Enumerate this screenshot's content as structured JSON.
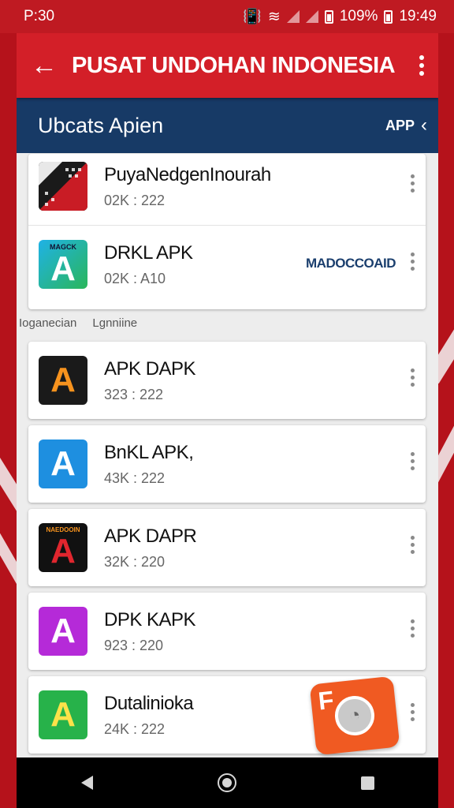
{
  "status_bar": {
    "time_left": "P:30",
    "battery_text": "109%",
    "time_right": "19:49"
  },
  "toolbar": {
    "title": "PUSAT UNDOHAN INDONESIA"
  },
  "section": {
    "title": "Ubcats Apien",
    "link": "APP",
    "link_icon": "chevron-left-icon"
  },
  "top_apps": [
    {
      "name": "PuyaNedgenInourah",
      "meta": "02K : 222",
      "icon": "flag-pattern-icon"
    },
    {
      "name": "DRKL APK",
      "meta": "02K : A10",
      "icon": "ap-logo-icon",
      "icon_text": "MAGCK",
      "tag": "MADOCCOAID"
    }
  ],
  "labels": [
    "Ioganecian",
    "Lgnniine"
  ],
  "apps": [
    {
      "name": "APK DAPK",
      "meta": "323 : 222",
      "icon": "a-logo-dark-icon"
    },
    {
      "name": "BnKL APK,",
      "meta": "43K : 222",
      "icon": "a-logo-blue-icon"
    },
    {
      "name": "APK DAPR",
      "meta": "32K : 220",
      "icon": "a-logo-red-icon",
      "icon_text": "NAEDOOIN"
    },
    {
      "name": "DPK KAPK",
      "meta": "923 : 220",
      "icon": "a-logo-purple-icon"
    },
    {
      "name": "Dutalinioka",
      "meta": "24K : 222",
      "icon": "a-logo-green-icon"
    }
  ],
  "overlay_badge": {
    "letter": "F",
    "icon": "camera-badge-icon"
  },
  "colors": {
    "toolbar": "#d31f28",
    "section_header": "#173a66",
    "background": "#b5121b"
  }
}
